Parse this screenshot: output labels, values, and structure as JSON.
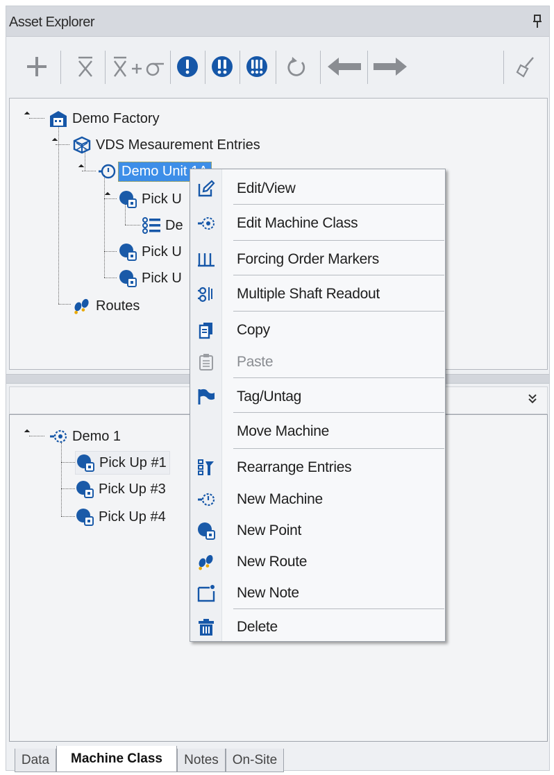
{
  "window": {
    "title": "Asset Explorer"
  },
  "toolbar": {
    "buttons": [
      {
        "name": "add-icon",
        "glyph": "+"
      },
      {
        "name": "xbar-icon",
        "glyph": "X̄"
      },
      {
        "name": "xbar-sigma-icon",
        "glyph": "X̄+σ"
      },
      {
        "name": "alert-1-icon",
        "glyph": "!"
      },
      {
        "name": "alert-2-icon",
        "glyph": "!!"
      },
      {
        "name": "alert-3-icon",
        "glyph": "!!!"
      },
      {
        "name": "refresh-icon",
        "glyph": "↻"
      },
      {
        "name": "arrow-left-icon",
        "glyph": "←"
      },
      {
        "name": "arrow-right-icon",
        "glyph": "→"
      },
      {
        "name": "broom-icon",
        "glyph": "🧹"
      }
    ]
  },
  "tree": {
    "root": "Demo Factory",
    "vds": "VDS Mesaurement Entries",
    "unit": "Demo Unit 1A",
    "pick1": "Pick U",
    "entry": "De",
    "pick2": "Pick U",
    "pick3": "Pick U",
    "routes": "Routes"
  },
  "machine_tree": {
    "root": "Demo 1",
    "items": [
      "Pick Up #1",
      "Pick Up #3",
      "Pick Up #4"
    ]
  },
  "context_menu": {
    "items": [
      {
        "label": "Edit/View",
        "icon": "edit-icon",
        "enabled": true
      },
      {
        "label": "Edit Machine Class",
        "icon": "machine-class-icon",
        "enabled": true
      },
      {
        "label": "Forcing Order Markers",
        "icon": "markers-icon",
        "enabled": true
      },
      {
        "label": "Multiple Shaft Readout",
        "icon": "shaft-icon",
        "enabled": true
      },
      {
        "label": "Copy",
        "icon": "copy-icon",
        "enabled": true
      },
      {
        "label": "Paste",
        "icon": "paste-icon",
        "enabled": false
      },
      {
        "label": "Tag/Untag",
        "icon": "flag-icon",
        "enabled": true
      },
      {
        "label": "Move Machine",
        "icon": "",
        "enabled": true
      },
      {
        "label": "Rearrange Entries",
        "icon": "rearrange-icon",
        "enabled": true
      },
      {
        "label": "New Machine",
        "icon": "machine-icon",
        "enabled": true
      },
      {
        "label": "New Point",
        "icon": "point-icon",
        "enabled": true
      },
      {
        "label": "New Route",
        "icon": "route-icon",
        "enabled": true
      },
      {
        "label": "New Note",
        "icon": "note-icon",
        "enabled": true
      },
      {
        "label": "Delete",
        "icon": "trash-icon",
        "enabled": true
      }
    ]
  },
  "tabs": [
    {
      "label": "Data",
      "active": false
    },
    {
      "label": "Machine Class",
      "active": true
    },
    {
      "label": "Notes",
      "active": false
    },
    {
      "label": "On-Site",
      "active": false
    }
  ],
  "colors": {
    "accent": "#1657a8",
    "selection": "#3d8ee8",
    "gray_icon": "#8a8d92"
  }
}
